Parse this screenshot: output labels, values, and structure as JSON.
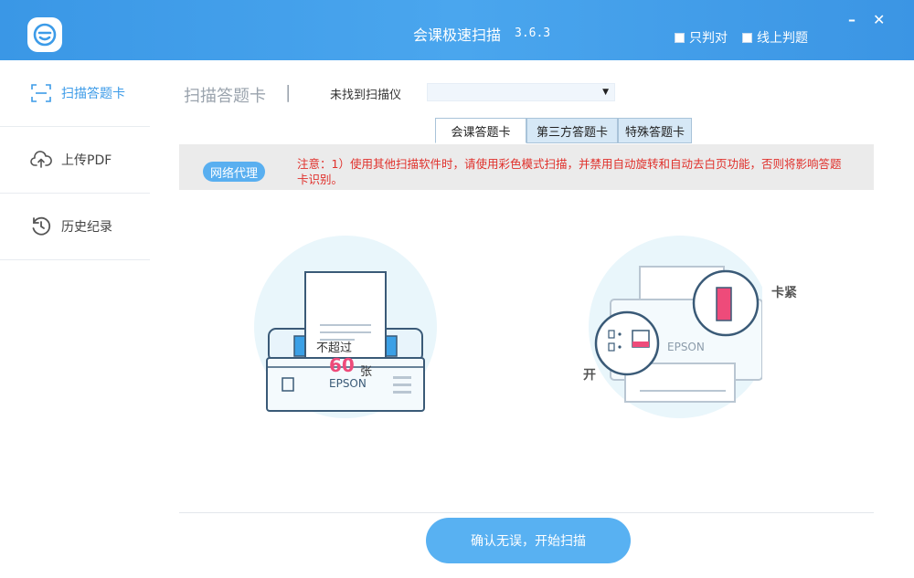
{
  "window": {
    "app_title": "会课极速扫描",
    "version": "3.6.3",
    "options": [
      {
        "label": "只判对",
        "checked": false
      },
      {
        "label": "线上判题",
        "checked": false
      }
    ],
    "minimize_glyph": "–",
    "close_glyph": "✕"
  },
  "sidebar": {
    "items": [
      {
        "label": "扫描答题卡",
        "icon": "scan-frame-icon",
        "active": true
      },
      {
        "label": "上传PDF",
        "icon": "cloud-upload-icon",
        "active": false
      },
      {
        "label": "历史纪录",
        "icon": "history-icon",
        "active": false
      }
    ]
  },
  "main": {
    "title": "扫描答题卡",
    "title_separator": "|",
    "scanner_label": "未找到扫描仪",
    "scanner_value": "",
    "tabs": [
      {
        "label": "会课答题卡",
        "active": true
      },
      {
        "label": "第三方答题卡",
        "active": false
      },
      {
        "label": "特殊答题卡",
        "active": false
      }
    ],
    "proxy_button": "网络代理",
    "notice": "注意：1）使用其他扫描软件时，请使用彩色模式扫描，并禁用自动旋转和自动去白页功能，否则将影响答题卡识别。",
    "illustration_left": {
      "sheet_text_top": "不超过",
      "sheet_number": "60",
      "sheet_unit": "张",
      "printer_brand": "EPSON"
    },
    "illustration_right": {
      "jam_label": "卡紧",
      "open_label": "开",
      "printer_brand": "EPSON"
    },
    "start_button": "确认无误，开始扫描"
  },
  "colors": {
    "titlebar": "#4aa6ee",
    "accent": "#3c9be8",
    "notice_text": "#e0302b",
    "highlight_pink": "#ee4b7a",
    "button": "#58b1f2"
  }
}
